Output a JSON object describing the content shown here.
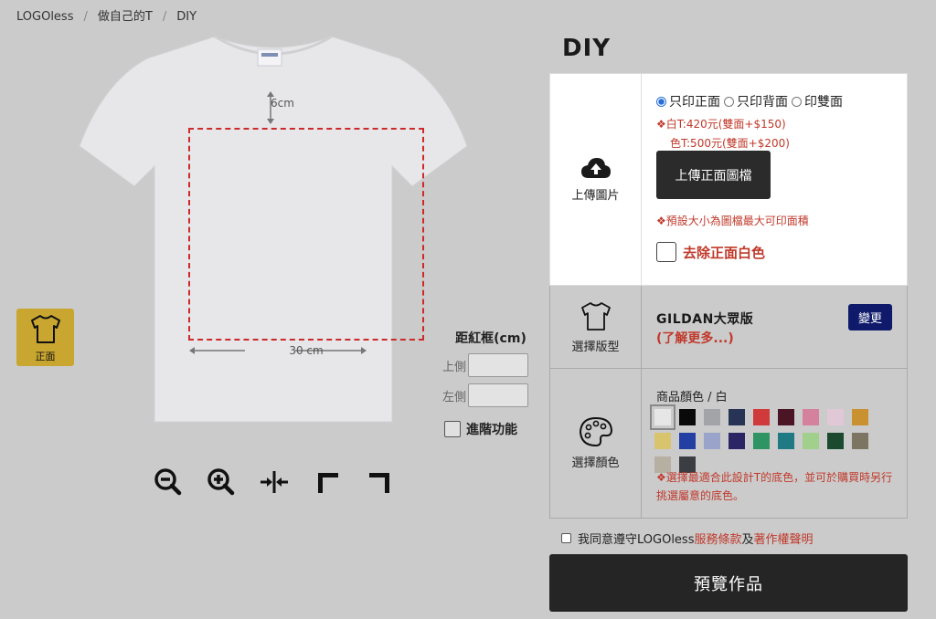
{
  "breadcrumb": [
    "LOGOless",
    "做自己的T",
    "DIY"
  ],
  "canvas": {
    "top_margin": "6cm",
    "width_label": "30 cm",
    "front_label": "正面"
  },
  "offset": {
    "title": "距紅框(cm)",
    "top_label": "上側",
    "top_value": "",
    "left_label": "左側",
    "left_value": "",
    "advanced_label": "進階功能"
  },
  "tools": [
    "zoom-out",
    "zoom-in",
    "center-horizontal",
    "align-top-left",
    "align-top-right"
  ],
  "title": "DIY",
  "upload": {
    "section_label": "上傳圖片",
    "print_options": [
      {
        "label": "只印正面",
        "selected": true
      },
      {
        "label": "只印背面",
        "selected": false
      },
      {
        "label": "印雙面",
        "selected": false
      }
    ],
    "price_white": "❖白T:420元(雙面+$150)",
    "price_color": "色T:500元(雙面+$200)",
    "upload_button": "上傳正面圖檔",
    "size_note": "❖預設大小為圖檔最大可印面積",
    "remove_white_label": "去除正面白色"
  },
  "pattern": {
    "section_label": "選擇版型",
    "model_name": "GILDAN大眾版",
    "learn_more": "(了解更多...)",
    "change_button": "變更"
  },
  "color": {
    "section_label": "選擇顏色",
    "label": "商品顏色 / 白",
    "swatches": [
      "#e6e6e6",
      "#0a0a0a",
      "#a3a4a8",
      "#283456",
      "#d03a3a",
      "#4c1526",
      "#d3819c",
      "#e0c8d6",
      "#c9912f",
      "#d9c46e",
      "#233fa3",
      "#9aa3c9",
      "#2b2566",
      "#2f9463",
      "#1f7a83",
      "#a0d08c",
      "#1b4a2e",
      "#7c7562",
      "#b5b0a2",
      "#3c3d42"
    ],
    "selected_index": 0,
    "note": "❖選擇最適合此設計T的底色，並可於購買時另行挑選屬意的底色。"
  },
  "agreement": {
    "prefix": "我同意遵守LOGOless",
    "terms": "服務條款",
    "and": "及",
    "copyright": "著作權聲明"
  },
  "preview_button": "預覽作品"
}
